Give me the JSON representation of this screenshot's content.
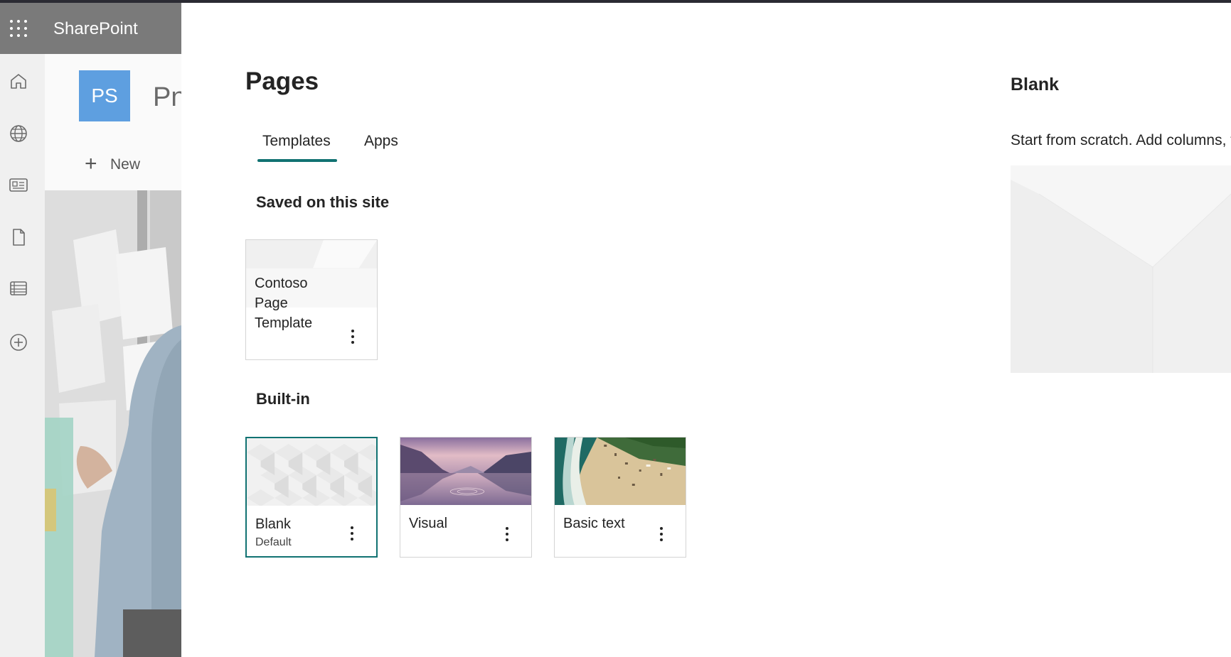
{
  "suite_bar": {
    "app_name": "SharePoint"
  },
  "site": {
    "logo_initials": "PS",
    "name_partial": "Pn",
    "new_label": "New"
  },
  "left_rail": {
    "icons": [
      "home-icon",
      "globe-icon",
      "news-icon",
      "document-icon",
      "list-icon",
      "add-circle-icon"
    ]
  },
  "panel": {
    "title": "Pages",
    "tabs": [
      {
        "label": "Templates",
        "active": true
      },
      {
        "label": "Apps",
        "active": false
      }
    ],
    "sections": {
      "saved": {
        "heading": "Saved on this site",
        "cards": [
          {
            "title": "Contoso Page Template"
          }
        ]
      },
      "builtin": {
        "heading": "Built-in",
        "cards": [
          {
            "title": "Blank",
            "subtitle": "Default",
            "selected": true
          },
          {
            "title": "Visual"
          },
          {
            "title": "Basic text"
          }
        ]
      }
    },
    "preview": {
      "title": "Blank",
      "description": "Start from scratch. Add columns, t"
    }
  },
  "colors": {
    "accent": "#117272",
    "logo_bg": "#5e9fe0",
    "suite_bar": "#7a7a7a"
  }
}
